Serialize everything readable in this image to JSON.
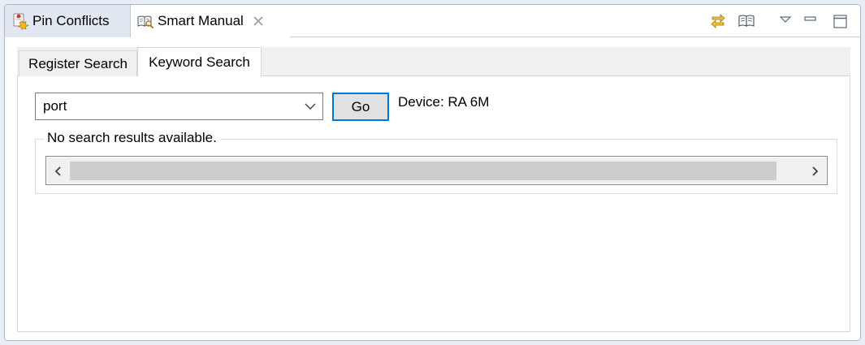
{
  "view_tabs": [
    {
      "label": "Pin Conflicts",
      "icon": "pin-conflicts-icon",
      "active": false
    },
    {
      "label": "Smart Manual",
      "icon": "smart-manual-icon",
      "active": true,
      "closeable": true
    }
  ],
  "toolbar": {
    "icons": [
      "sync-icon",
      "manual-book-icon",
      "view-menu-icon",
      "minimize-icon",
      "maximize-icon"
    ]
  },
  "notebook": {
    "tabs": [
      {
        "label": "Register Search",
        "active": false
      },
      {
        "label": "Keyword Search",
        "active": true
      }
    ]
  },
  "search": {
    "value": "port",
    "go_label": "Go",
    "device_label": "Device: RA 6M"
  },
  "results": {
    "legend": "No search results available."
  },
  "colors": {
    "frame_bg": "#e9eef6",
    "accent_focus": "#0078d7",
    "inactive_tab_bg": "#e2e8f1"
  }
}
